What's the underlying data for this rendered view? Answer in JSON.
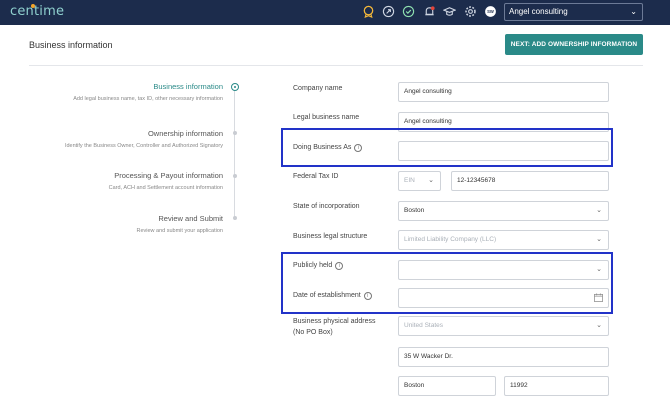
{
  "header": {
    "logo_text": "centime",
    "account_selector": "Angel consulting",
    "icons": [
      "award-icon",
      "rocket-icon",
      "shield-check-icon",
      "bell-icon",
      "graduation-cap-icon",
      "gear-icon",
      "user-avatar-icon"
    ]
  },
  "page": {
    "title": "Business information",
    "next_button": "NEXT: ADD OWNERSHIP INFORMATION"
  },
  "steps": [
    {
      "title": "Business information",
      "desc": "Add legal business name, tax ID, other necessary information",
      "active": true
    },
    {
      "title": "Ownership information",
      "desc": "Identify the Business Owner, Controller and Authorized Signatory",
      "active": false
    },
    {
      "title": "Processing & Payout information",
      "desc": "Card, ACH and Settlement account information",
      "active": false
    },
    {
      "title": "Review and Submit",
      "desc": "Review and submit your application",
      "active": false
    }
  ],
  "form": {
    "company_name": {
      "label": "Company name",
      "value": "Angel consulting"
    },
    "legal_name": {
      "label": "Legal business name",
      "value": "Angel consulting"
    },
    "dba": {
      "label": "Doing Business As",
      "value": ""
    },
    "federal_tax": {
      "label": "Federal Tax ID",
      "type": "EIN",
      "value": "12-12345678"
    },
    "state": {
      "label": "State of incorporation",
      "value": "Boston"
    },
    "structure": {
      "label": "Business legal structure",
      "value": "Limited Liability Company (LLC)"
    },
    "publicly_held": {
      "label": "Publicly held",
      "value": ""
    },
    "established": {
      "label": "Date of establishment",
      "value": ""
    },
    "address": {
      "label_line1": "Business physical address",
      "label_line2": "(No PO Box)",
      "country": "United States",
      "street": "35 W Wacker Dr.",
      "city": "Boston",
      "zip": "11992"
    }
  },
  "colors": {
    "accent": "#2a8a88",
    "header_bg": "#1c2c4c",
    "highlight": "#2233c8"
  }
}
